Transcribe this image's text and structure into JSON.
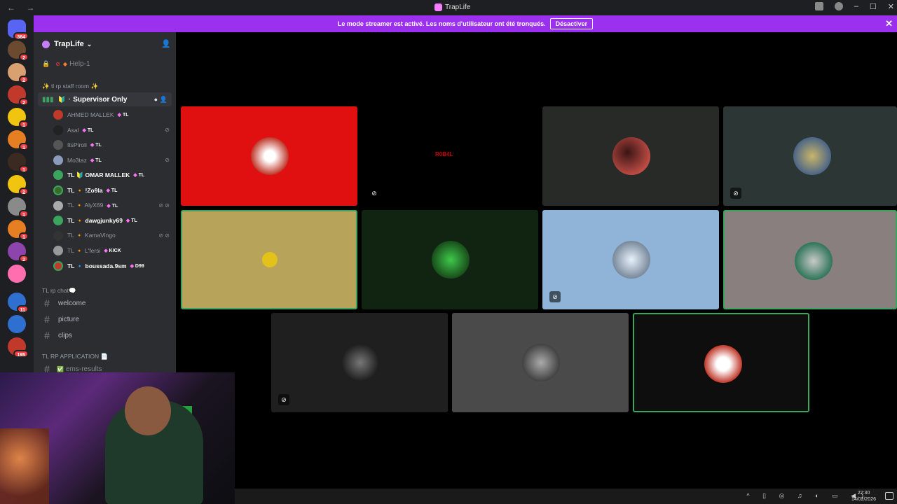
{
  "window": {
    "title": "TrapLife",
    "nav_glyphs": "← →"
  },
  "banner": {
    "message": "Le mode streamer est activé. Les noms d'utilisateur ont été tronqués.",
    "button": "Désactiver",
    "close": "✕"
  },
  "servers": [
    {
      "badge": "364"
    },
    {
      "badge": "2"
    },
    {
      "badge": "2"
    },
    {
      "badge": "2"
    },
    {
      "badge": "1"
    },
    {
      "badge": "1"
    },
    {
      "badge": "1"
    },
    {
      "badge": "2"
    },
    {
      "badge": "1"
    },
    {
      "badge": "1"
    },
    {
      "badge": "2"
    },
    {
      "badge": ""
    },
    {
      "badge": "11"
    },
    {
      "badge": ""
    },
    {
      "badge": "195"
    }
  ],
  "guild": {
    "name": "TrapLife",
    "chevron": "⌄"
  },
  "sidebar": {
    "help_channel": "Help-1",
    "staff_category": "✨ tl rp staff room ✨",
    "voice_channel": "Supervisor Only",
    "users": [
      {
        "name": "AHMED MALLEK",
        "tag": "TL",
        "live": false
      },
      {
        "name": "Asal",
        "tag": "TL",
        "live": false
      },
      {
        "name": "ItsPiroli",
        "tag": "TL",
        "live": false
      },
      {
        "name": "Mo3taz",
        "tag": "TL",
        "live": false
      },
      {
        "name": "TL 🔰 OMAR MALLEK",
        "tag": "TL",
        "live": true
      },
      {
        "name": "TL 🔸 !Zo9la",
        "tag": "TL",
        "live": true
      },
      {
        "name": "TL 🔸 AlyX69",
        "tag": "TL",
        "live": false
      },
      {
        "name": "TL 🔸 dawgjunky69",
        "tag": "TL",
        "live": true
      },
      {
        "name": "TL 🔸 KamaVingo",
        "tag": "",
        "live": false
      },
      {
        "name": "TL 🔸 L'fersi",
        "tag": "KICK",
        "live": false
      },
      {
        "name": "TL 🔹 boussada.9sm",
        "tag": "D99",
        "live": true
      }
    ],
    "chat_category": "TL rp chat🗨️",
    "channels": [
      "welcome",
      "picture",
      "clips"
    ],
    "app_category": "TL RP APPLICATION 📄",
    "app_channel": "ems-results"
  },
  "tiles_text": {
    "tile2_label": "R0B4L"
  },
  "taskbar": {
    "time": "22:30",
    "date": "14/02/2026"
  },
  "colors": {
    "accent": "#9b31ef",
    "speaking": "#3ba55d",
    "badge": "#f23f43"
  }
}
